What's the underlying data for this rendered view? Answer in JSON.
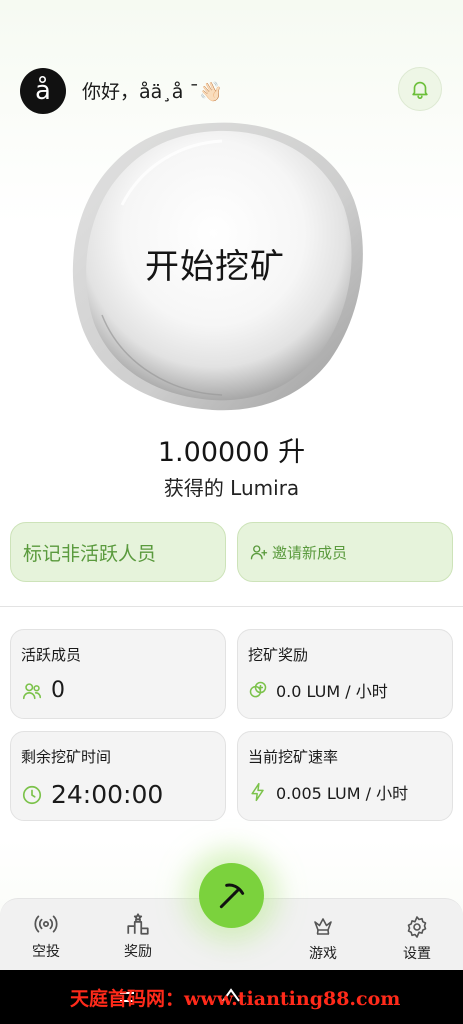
{
  "header": {
    "avatar_letter": "å",
    "greeting": "你好，åä¸å ¯👋🏻",
    "bell_icon": "bell-icon"
  },
  "orb": {
    "label": "开始挖矿"
  },
  "balance": {
    "amount": "1.00000 升",
    "earned_label": "获得的 Lumira"
  },
  "actions": {
    "mark_inactive": "标记非活跃人员",
    "invite": "邀请新成员"
  },
  "stats": {
    "active_members": {
      "title": "活跃成员",
      "value": "0"
    },
    "mining_reward": {
      "title": "挖矿奖励",
      "value": "0.0 LUM / 小时"
    },
    "time_remaining": {
      "title": "剩余挖矿时间",
      "value": "24:00:00"
    },
    "mining_rate": {
      "title": "当前挖矿速率",
      "value": "0.005 LUM / 小时"
    }
  },
  "nav": {
    "airdrop": "空投",
    "rewards": "奖励",
    "games": "游戏",
    "settings": "设置"
  },
  "system": {
    "watermark": "天庭首码网：www.tianting88.com"
  },
  "colors": {
    "accent": "#7bd23d",
    "accent_text": "#5a9a3d",
    "pill_bg": "#e6f3db"
  }
}
